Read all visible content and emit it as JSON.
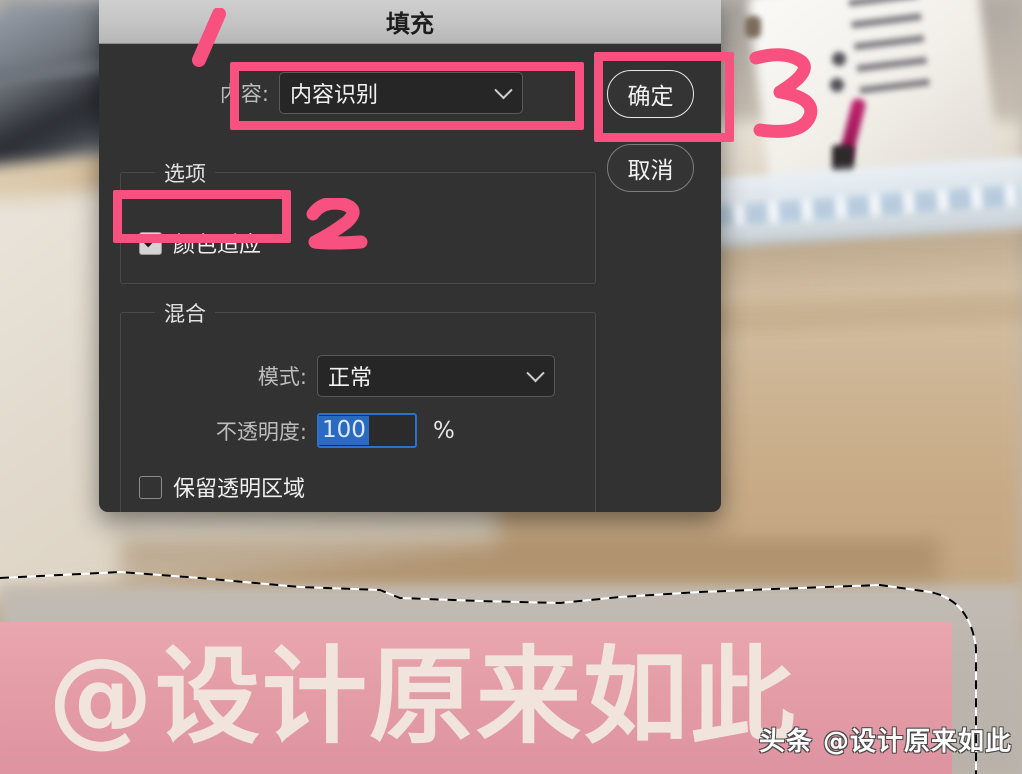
{
  "dialog": {
    "title": "填充",
    "content_row": {
      "label": "内容:",
      "selected": "内容识别",
      "chevron_icon": "chevron-down-icon"
    },
    "options_group": {
      "title": "选项",
      "color_adaptation": {
        "label": "颜色适应",
        "checked": true
      }
    },
    "blend_group": {
      "title": "混合",
      "mode_row": {
        "label": "模式:",
        "selected": "正常",
        "chevron_icon": "chevron-down-icon"
      },
      "opacity_row": {
        "label": "不透明度:",
        "value": "100",
        "unit": "%"
      },
      "preserve_transparency": {
        "label": "保留透明区域",
        "checked": false
      }
    },
    "buttons": {
      "ok": "确定",
      "cancel": "取消"
    }
  },
  "annotations": {
    "step_1": "1",
    "step_2": "2",
    "step_3": "3",
    "highlight_color": "#f8507f"
  },
  "watermark": {
    "banner_text": "@设计原来如此",
    "banner_color": "#e79ba6",
    "corner_logo": "头条 @设计原来如此"
  },
  "colors": {
    "dialog_bg": "#323232",
    "titlebar_bg": "#c4c4c4",
    "field_bg": "#262626",
    "focus_blue": "#2f6fd0",
    "selection_blue": "#2a6bbf",
    "text_primary": "#f2f2f2",
    "text_secondary": "#bdbdbd"
  }
}
